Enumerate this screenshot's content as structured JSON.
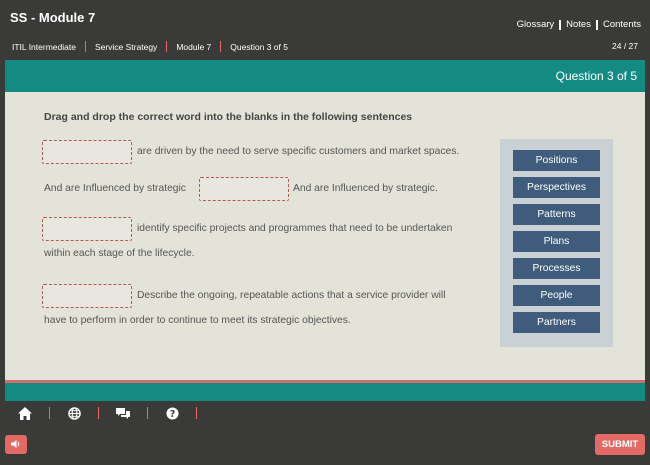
{
  "header": {
    "title": "SS - Module 7",
    "links": [
      "Glossary",
      "Notes",
      "Contents"
    ]
  },
  "breadcrumb": {
    "items": [
      "ITIL Intermediate",
      "Service Strategy",
      "Module 7",
      "Question 3 of 5"
    ],
    "page_count": "24 / 27"
  },
  "banner": {
    "question_label": "Question 3 of 5"
  },
  "question": {
    "instruction": "Drag and drop the correct word into the blanks in the following sentences",
    "sentences": [
      {
        "text": "are driven by the need to serve specific customers and market spaces."
      },
      {
        "before": "And are Influenced by strategic",
        "after": "And are Influenced by strategic."
      },
      {
        "line1": "identify specific projects and programmes that need to be undertaken",
        "line2": "within each stage of the lifecycle."
      },
      {
        "line1": "Describe the ongoing, repeatable actions that a service provider will",
        "line2": "have to perform in order to continue to meet its strategic objectives."
      }
    ]
  },
  "word_bank": [
    "Positions",
    "Perspectives",
    "Patterns",
    "Plans",
    "Processes",
    "People",
    "Partners"
  ],
  "footer": {
    "icons": [
      "home-icon",
      "globe-icon",
      "chat-icon",
      "help-icon"
    ],
    "sound_icon": "speaker-icon",
    "submit_label": "SUBMIT"
  },
  "colors": {
    "background": "#3a3a38",
    "teal": "#138a82",
    "coral": "#e36b66",
    "content": "#e4e3da",
    "word_tile": "#3f5c7c",
    "bank": "#c9d1d4"
  }
}
